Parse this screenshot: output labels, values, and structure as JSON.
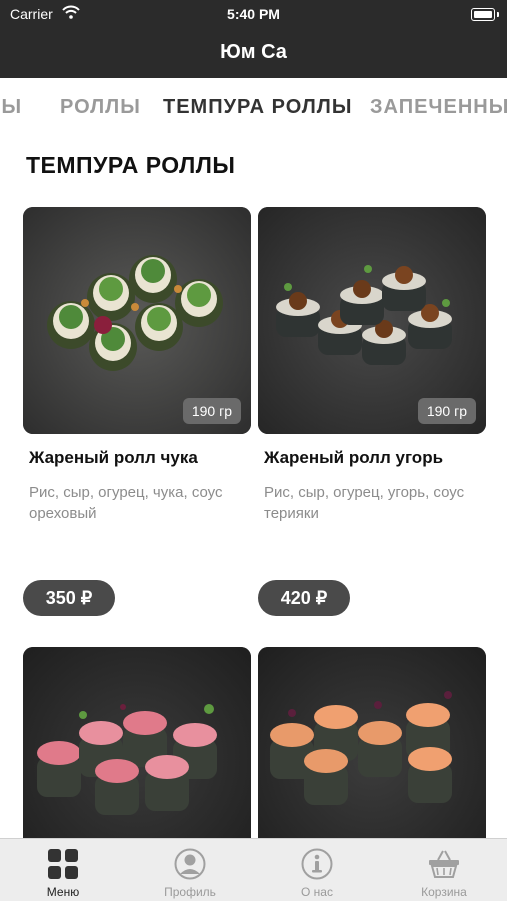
{
  "status_bar": {
    "carrier": "Carrier",
    "time": "5:40 PM"
  },
  "header": {
    "title": "Юм Са"
  },
  "category_tabs": [
    {
      "label": "НЫ"
    },
    {
      "label": "РОЛЛЫ"
    },
    {
      "label": "ТЕМПУРА РОЛЛЫ",
      "active": true
    },
    {
      "label": "ЗАПЕЧЕННЫЕ"
    }
  ],
  "section": {
    "title": "ТЕМПУРА РОЛЛЫ"
  },
  "products": [
    {
      "name": "Жареный ролл чука",
      "description": "Рис, сыр, огурец, чука, соус ореховый",
      "weight": "190 гр",
      "price": "350 ₽"
    },
    {
      "name": "Жареный ролл угорь",
      "description": "Рис, сыр, огурец, угорь, соус терияки",
      "weight": "190 гр",
      "price": "420 ₽"
    },
    {
      "name": "",
      "description": "",
      "weight": "",
      "price": ""
    },
    {
      "name": "",
      "description": "",
      "weight": "",
      "price": ""
    }
  ],
  "tab_bar": [
    {
      "label": "Меню",
      "icon": "grid-icon",
      "active": true
    },
    {
      "label": "Профиль",
      "icon": "user-icon"
    },
    {
      "label": "О нас",
      "icon": "info-icon"
    },
    {
      "label": "Корзина",
      "icon": "basket-icon"
    }
  ],
  "colors": {
    "header_bg": "#2b2b2b",
    "price_pill": "#4a4a4a",
    "weight_badge": "#6a6a6a",
    "tab_inactive": "#9a9a9a"
  }
}
